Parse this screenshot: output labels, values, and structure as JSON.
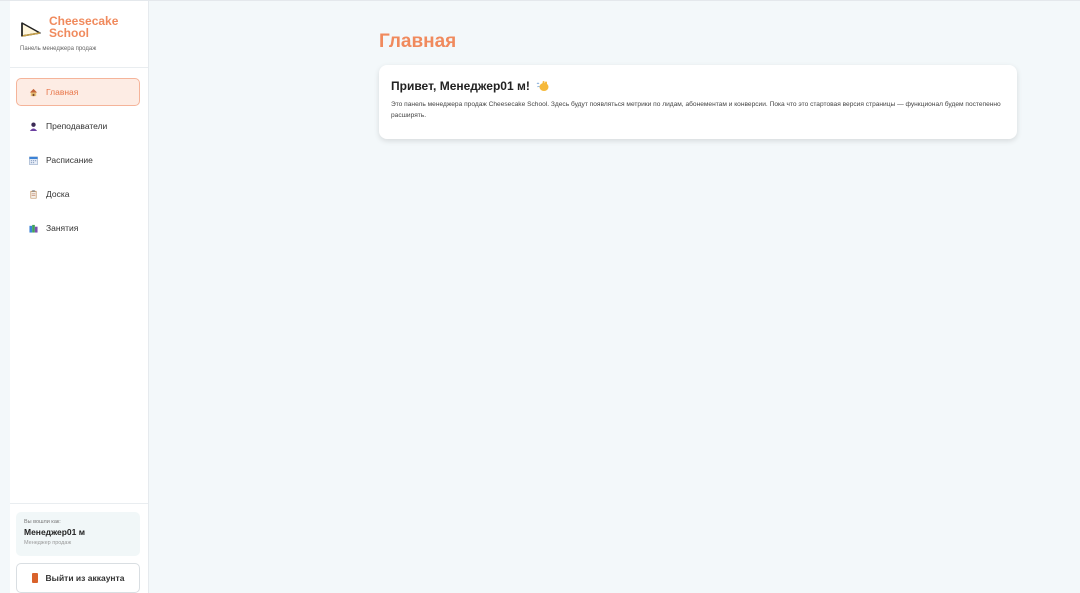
{
  "brand": {
    "name": "Cheesecake School",
    "subtitle": "Панель менеджера продаж"
  },
  "sidebar": {
    "items": [
      {
        "label": "Главная",
        "icon": "house-icon",
        "active": true
      },
      {
        "label": "Преподаватели",
        "icon": "teacher-icon",
        "active": false
      },
      {
        "label": "Расписание",
        "icon": "calendar-icon",
        "active": false
      },
      {
        "label": "Доска",
        "icon": "clipboard-icon",
        "active": false
      },
      {
        "label": "Занятия",
        "icon": "books-icon",
        "active": false
      }
    ]
  },
  "user": {
    "logged_in_as": "Вы вошли как:",
    "name": "Менеджер01 м",
    "role": "Менеджер продаж"
  },
  "logout": {
    "label": "Выйти из аккаунта"
  },
  "main": {
    "title": "Главная",
    "card": {
      "title": "Привет, Менеджер01 м!",
      "text": "Это панель менеджера продаж Cheesecake School. Здесь будут появляться метрики по лидам, абонементам и конверсии. Пока что это стартовая версия страницы — функционал будем постепенно расширять."
    }
  },
  "colors": {
    "accent": "#f08a5d",
    "active_bg": "#fdece4",
    "page_bg": "#f3f8fa"
  }
}
